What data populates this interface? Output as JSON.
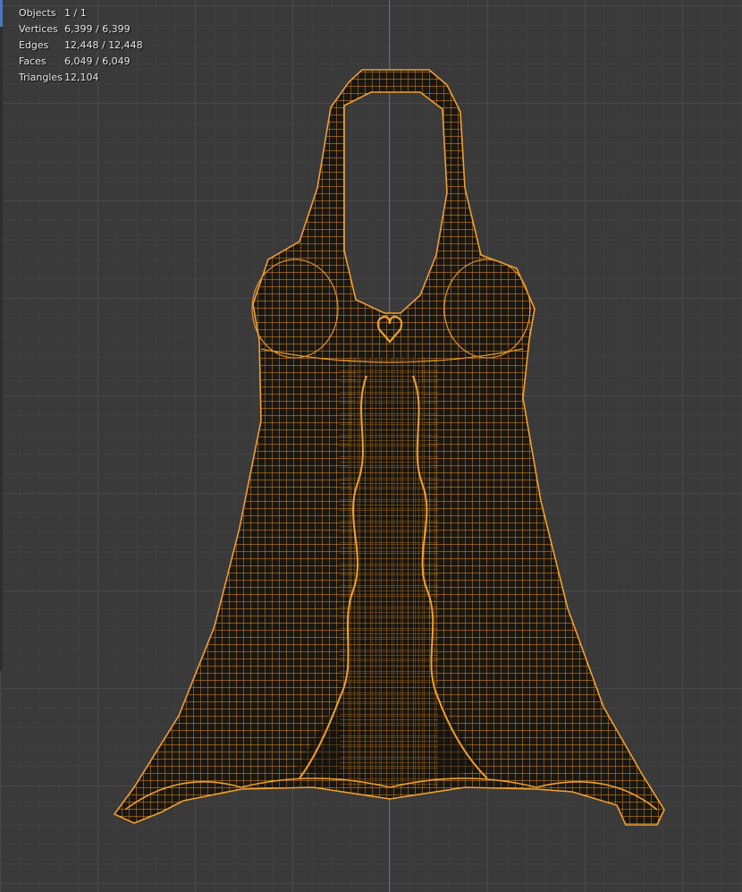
{
  "overlay": {
    "stats": [
      {
        "label": "Objects",
        "value": "1 / 1"
      },
      {
        "label": "Vertices",
        "value": "6,399 / 6,399"
      },
      {
        "label": "Edges",
        "value": "12,448 / 12,448"
      },
      {
        "label": "Faces",
        "value": "6,049 / 6,049"
      },
      {
        "label": "Triangles",
        "value": "12,104"
      }
    ]
  },
  "colors": {
    "grid_background": "#3a3a3a",
    "z_axis": "#3d6fb8",
    "wireframe": "#e5952a",
    "mesh_fill": "#1a1712"
  },
  "object": {
    "mode": "wireframe",
    "subject": "halter-dress-mesh"
  }
}
